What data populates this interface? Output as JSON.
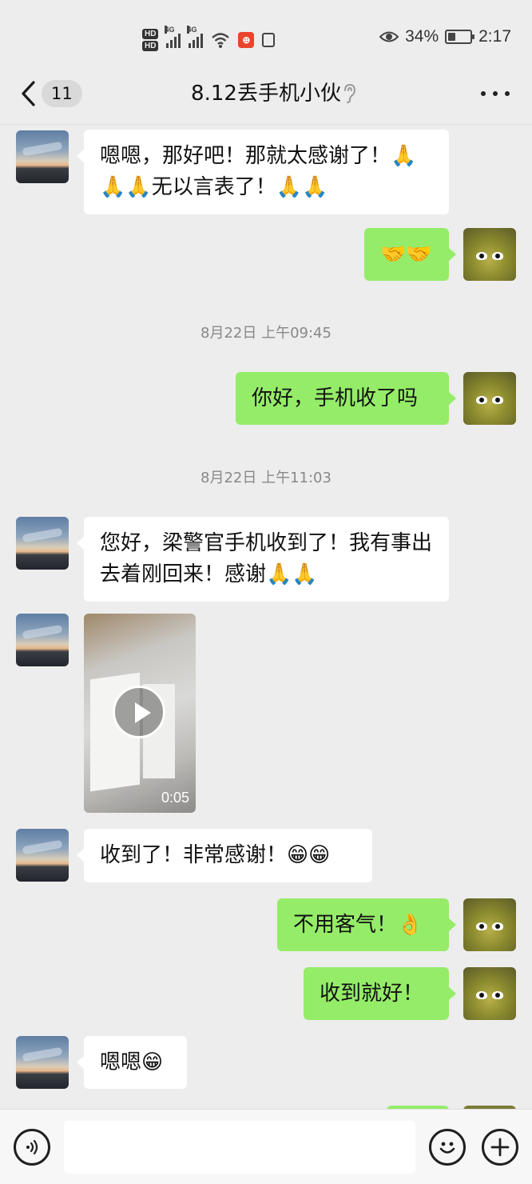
{
  "status_bar": {
    "hd1": "HD",
    "hd2": "HD",
    "net1": "4G",
    "net2": "4G",
    "battery_percent": "34%",
    "battery_level": 0.34,
    "time": "2:17"
  },
  "header": {
    "unread_count": "11",
    "title": "8.12丢手机小伙"
  },
  "messages": [
    {
      "side": "in",
      "type": "text",
      "text": "嗯嗯，那好吧！那就太感谢了！🙏🙏🙏无以言表了！🙏🙏"
    },
    {
      "side": "out",
      "type": "text",
      "text": "🤝🤝"
    },
    {
      "type": "time",
      "text": "8月22日 上午09:45"
    },
    {
      "side": "out",
      "type": "text",
      "text": "你好，手机收了吗"
    },
    {
      "type": "time",
      "text": "8月22日 上午11:03"
    },
    {
      "side": "in",
      "type": "text",
      "text": "您好，梁警官手机收到了！我有事出去着刚回来！感谢🙏🙏"
    },
    {
      "side": "in",
      "type": "video",
      "duration": "0:05"
    },
    {
      "side": "in",
      "type": "text",
      "text": "收到了！非常感谢！😁😁"
    },
    {
      "side": "out",
      "type": "text",
      "text": "不用客气！👌"
    },
    {
      "side": "out",
      "type": "text",
      "text": "收到就好！"
    },
    {
      "side": "in",
      "type": "text",
      "text": "嗯嗯😁"
    }
  ],
  "input": {
    "value": ""
  }
}
